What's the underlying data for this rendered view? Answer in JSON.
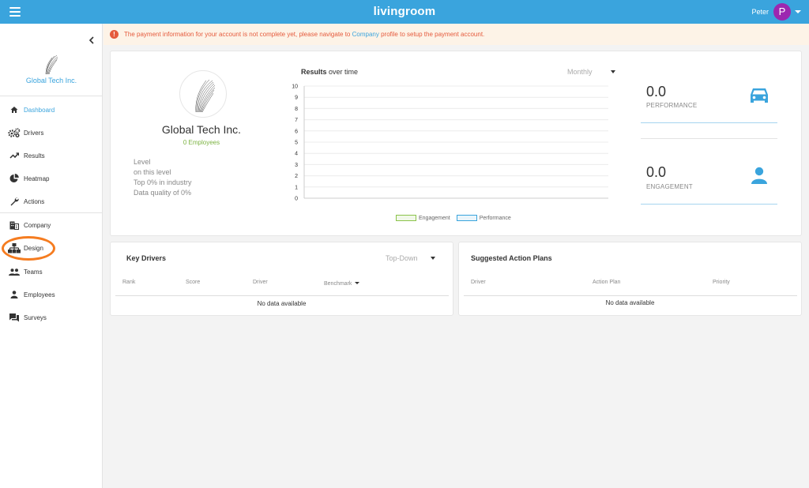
{
  "header": {
    "brand": "livingroom",
    "user_name": "Peter",
    "avatar_initial": "P"
  },
  "sidebar": {
    "company_name": "Global Tech Inc.",
    "items": [
      {
        "label": "Dashboard",
        "icon": "home-icon",
        "active": true
      },
      {
        "label": "Drivers",
        "icon": "gears-icon"
      },
      {
        "label": "Results",
        "icon": "trending-up-icon"
      },
      {
        "label": "Heatmap",
        "icon": "pie-chart-icon"
      },
      {
        "label": "Actions",
        "icon": "wrench-icon"
      },
      {
        "label": "Company",
        "icon": "building-icon"
      },
      {
        "label": "Design",
        "icon": "org-chart-icon"
      },
      {
        "label": "Teams",
        "icon": "people-icon"
      },
      {
        "label": "Employees",
        "icon": "person-icon"
      },
      {
        "label": "Surveys",
        "icon": "chat-bubbles-icon"
      }
    ]
  },
  "alert": {
    "icon": "exclamation-icon",
    "text_before": "The payment information for your account is not complete yet, please navigate to ",
    "link": "Company",
    "text_after": " profile to setup the payment account."
  },
  "org": {
    "name": "Global Tech Inc.",
    "employees": "0 Employees",
    "stats": [
      "Level",
      "on this level",
      "Top 0% in industry",
      "Data quality of 0%"
    ]
  },
  "chart": {
    "title_bold": "Results",
    "title_rest": " over time",
    "period": "Monthly",
    "legend": [
      {
        "name": "Engagement",
        "border": "#8bc34a",
        "fill": "#f1f8e9"
      },
      {
        "name": "Performance",
        "border": "#3aa4dd",
        "fill": "#eaf5fb"
      }
    ]
  },
  "chart_data": {
    "type": "line",
    "title": "Results over time",
    "x": [],
    "series": [
      {
        "name": "Engagement",
        "values": []
      },
      {
        "name": "Performance",
        "values": []
      }
    ],
    "ylim": [
      0,
      10
    ],
    "yticks": [
      "0",
      "1",
      "2",
      "3",
      "4",
      "5",
      "6",
      "7",
      "8",
      "9",
      "10"
    ],
    "grid": true,
    "legend": "bottom"
  },
  "kpis": [
    {
      "value": "0.0",
      "label": "PERFORMANCE",
      "icon": "car-icon"
    },
    {
      "value": "0.0",
      "label": "ENGAGEMENT",
      "icon": "person-icon"
    }
  ],
  "key_drivers": {
    "title": "Key Drivers",
    "dropdown": "Top-Down",
    "columns": [
      "Rank",
      "Score",
      "Driver",
      "Benchmark"
    ],
    "empty": "No data available"
  },
  "action_plans": {
    "title": "Suggested Action Plans",
    "columns": [
      "Driver",
      "Action Plan",
      "Priority"
    ],
    "empty": "No data available"
  },
  "colors": {
    "primary": "#3aa4dd",
    "alert": "#e55a3c",
    "success": "#7cb342",
    "avatar": "#9c27b0",
    "highlight": "#f57c20"
  }
}
